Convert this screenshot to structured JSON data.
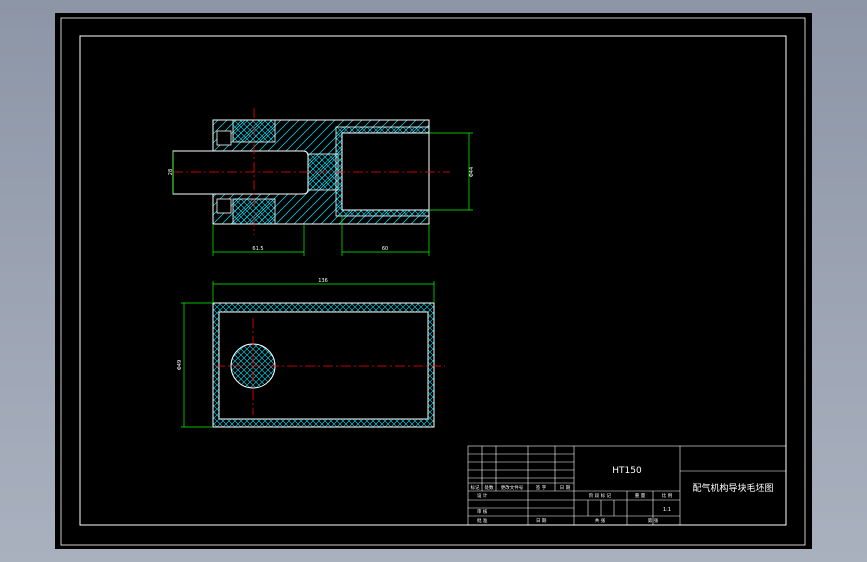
{
  "dimensions": {
    "shaft_dia": "28",
    "outer_dia": "Φ44",
    "left_length": "61.5",
    "right_length": "60",
    "top_length": "136",
    "height": "Φ49"
  },
  "title_block": {
    "material": "HT150",
    "part_name": "配气机构导块毛坯图",
    "scale": "1:1",
    "rev_headers": [
      "标记",
      "处数",
      "更改文件号",
      "签 字",
      "日 期"
    ],
    "row_design": "设 计",
    "row_review": "审 核",
    "row_approve": "批 准",
    "stage_label": "阶 段 标 记",
    "weight_label": "重 量",
    "scale_label": "比 例",
    "sheets_label": "共   张",
    "sheet_label": "第   张",
    "date_label": "日 期"
  },
  "colors": {
    "background": "#000000",
    "outline": "#ffffff",
    "dimension": "#00ff00",
    "centerline": "#ff0000",
    "hatch": "#00e5ff"
  }
}
